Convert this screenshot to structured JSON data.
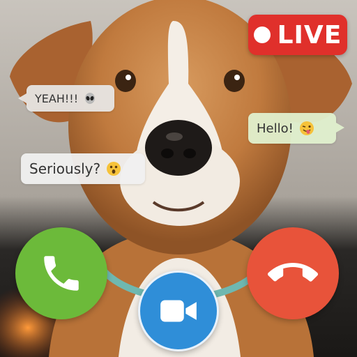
{
  "live_badge": {
    "label": "LIVE",
    "color": "#e0302b"
  },
  "chat_bubbles": [
    {
      "text": "YEAH!!!",
      "emoji": "alien-face"
    },
    {
      "text": "Hello!",
      "emoji": "winking-tongue-face"
    },
    {
      "text": "Seriously?",
      "emoji": "astonished-face"
    }
  ],
  "call_controls": {
    "accept": {
      "icon": "phone-icon",
      "color": "#6cba3a"
    },
    "video": {
      "icon": "video-camera-icon",
      "color": "#2f8ed8"
    },
    "decline": {
      "icon": "phone-hangup-icon",
      "color": "#e8533a"
    }
  }
}
